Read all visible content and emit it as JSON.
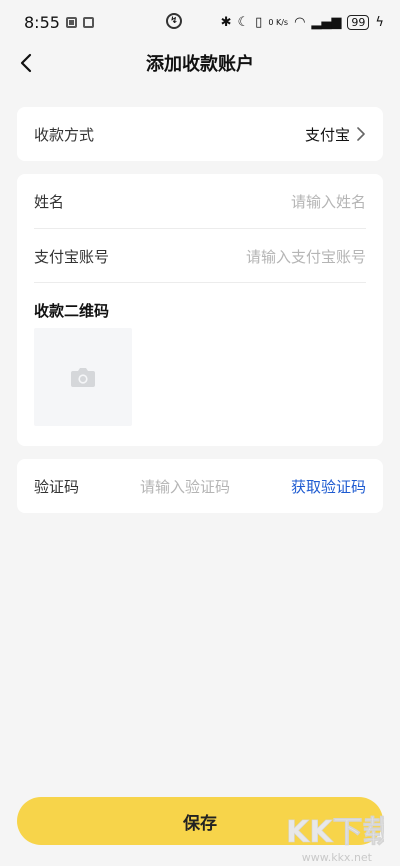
{
  "status_bar": {
    "time": "8:55",
    "net_speed": "0 K/s",
    "battery": "99"
  },
  "header": {
    "title": "添加收款账户"
  },
  "payment_method": {
    "label": "收款方式",
    "value": "支付宝"
  },
  "form": {
    "name_label": "姓名",
    "name_placeholder": "请输入姓名",
    "account_label": "支付宝账号",
    "account_placeholder": "请输入支付宝账号",
    "qr_title": "收款二维码"
  },
  "verification": {
    "label": "验证码",
    "placeholder": "请输入验证码",
    "get_code": "获取验证码"
  },
  "save_label": "保存",
  "watermark": {
    "url": "www.kkx.net"
  },
  "colors": {
    "accent": "#f7d44a",
    "link": "#1e5bd1"
  }
}
